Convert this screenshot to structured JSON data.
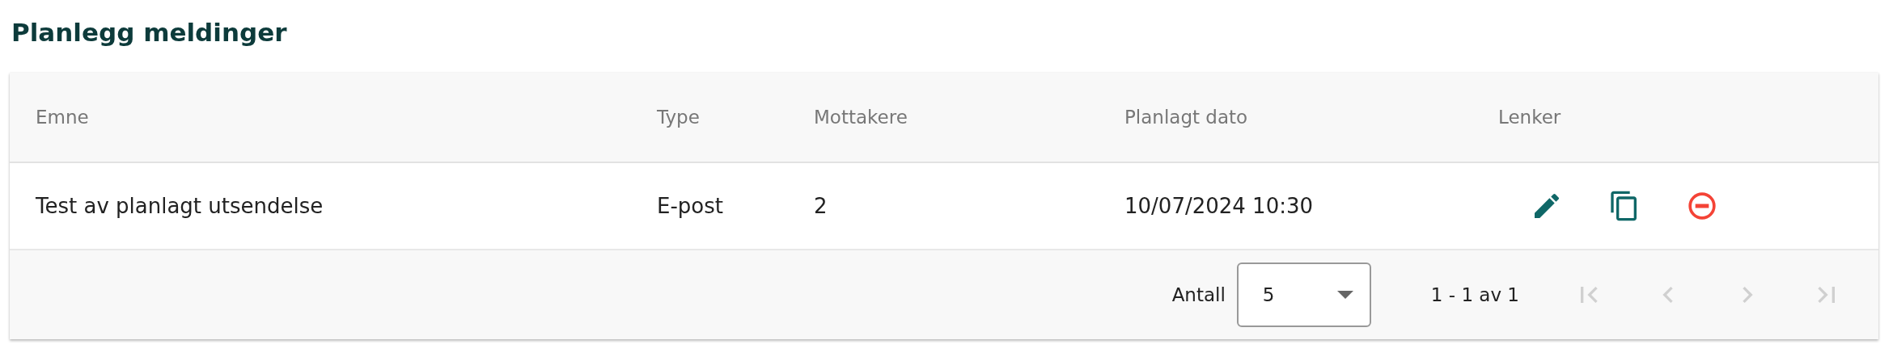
{
  "title": "Planlegg meldinger",
  "table": {
    "columns": [
      "Emne",
      "Type",
      "Mottakere",
      "Planlagt dato",
      "Lenker"
    ],
    "rows": [
      {
        "cells": [
          "Test av planlagt utsendelse",
          "E-post",
          "2",
          "10/07/2024 10:30"
        ],
        "actions": [
          {
            "kind": "edit"
          },
          {
            "kind": "copy"
          },
          {
            "kind": "remove"
          }
        ]
      }
    ]
  },
  "paginator": {
    "page_size_label": "Antall",
    "page_size": "5",
    "range": "1 - 1 av 1",
    "buttons": [
      {
        "kind": "first",
        "disabled": true
      },
      {
        "kind": "previous",
        "disabled": true
      },
      {
        "kind": "next",
        "disabled": true
      },
      {
        "kind": "last",
        "disabled": true
      }
    ]
  }
}
